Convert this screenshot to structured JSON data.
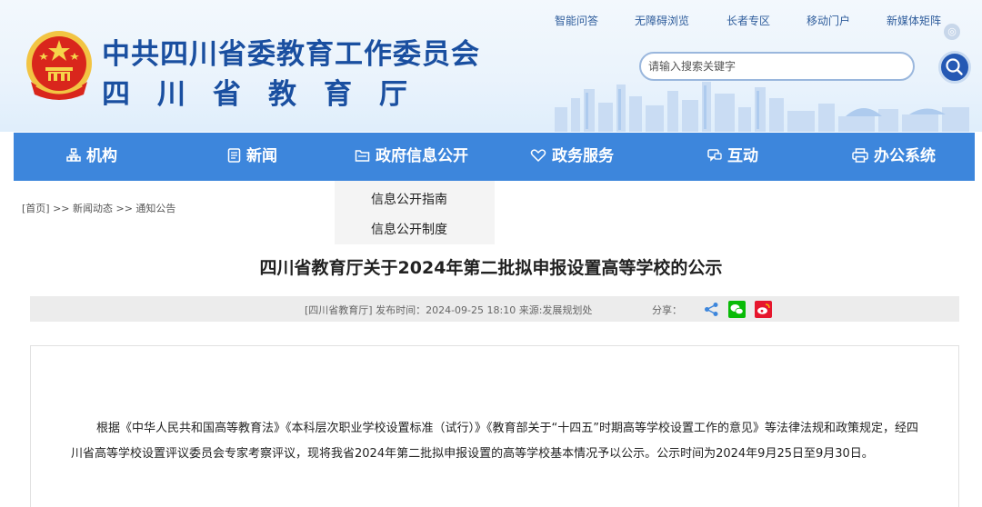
{
  "header": {
    "org_name": "中共四川省委教育工作委员会",
    "dept_name": "四川省教育厅",
    "top_links": [
      "智能问答",
      "无障碍浏览",
      "长者专区",
      "移动门户",
      "新媒体矩阵"
    ],
    "search_placeholder": "请输入搜索关键字"
  },
  "nav": {
    "items": [
      {
        "label": "机构",
        "icon": "org-chart-icon"
      },
      {
        "label": "新闻",
        "icon": "news-icon"
      },
      {
        "label": "政府信息公开",
        "icon": "folder-icon"
      },
      {
        "label": "政务服务",
        "icon": "heart-hands-icon"
      },
      {
        "label": "互动",
        "icon": "chat-icon"
      },
      {
        "label": "办公系统",
        "icon": "printer-icon"
      }
    ],
    "dropdown": [
      "信息公开指南",
      "信息公开制度"
    ]
  },
  "breadcrumb": "[首页] >> 新闻动态 >> 通知公告",
  "article": {
    "title": "四川省教育厅关于2024年第二批拟申报设置高等学校的公示",
    "meta": "[四川省教育厅]   发布时间：2024-09-25 18:10   来源:发展规划处",
    "share_label": "分享：",
    "paragraph": "根据《中华人民共和国高等教育法》《本科层次职业学校设置标准（试行）》《教育部关于“十四五”时期高等学校设置工作的意见》等法律法规和政策规定，经四川省高等学校设置评议委员会专家考察评议，现将我省2024年第二批拟申报设置的高等学校基本情况予以公示。公示时间为2024年9月25日至9月30日。"
  },
  "colors": {
    "brand_blue": "#1a4fa0",
    "nav_blue": "#3d86dc",
    "search_button": "#2559b4",
    "wechat_green": "#09bb07",
    "weibo_red": "#e6162d"
  }
}
